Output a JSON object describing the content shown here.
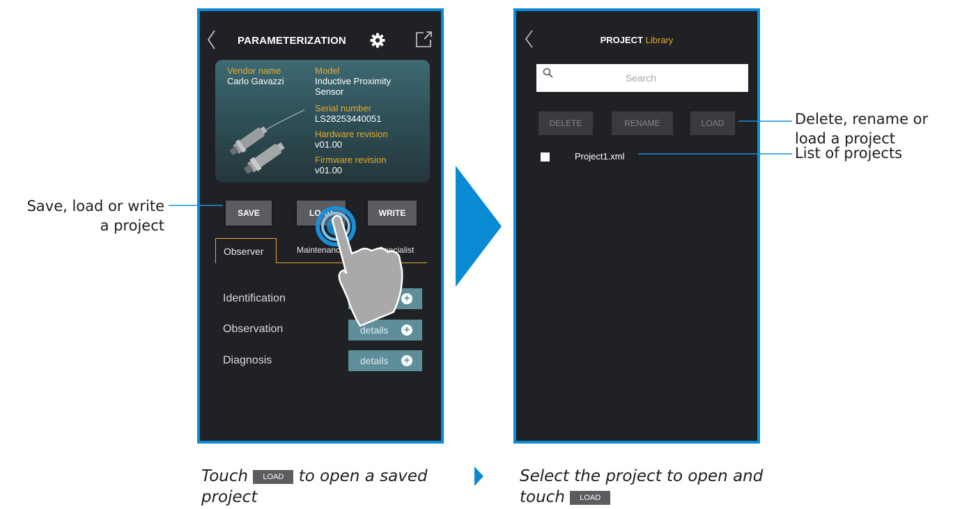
{
  "left_screen": {
    "title": "PARAMETERIZATION",
    "device": {
      "vendor_label": "Vendor name",
      "vendor_value": "Carlo Gavazzi",
      "model_label": "Model",
      "model_value_line1": "Inductive Proximity",
      "model_value_line2": "Sensor",
      "serial_label": "Serial number",
      "serial_value": "LS28253440051",
      "hardware_label": "Hardware revision",
      "hardware_value": "v01.00",
      "firmware_label": "Firmware revision",
      "firmware_value": "v01.00"
    },
    "actions": {
      "save": "SAVE",
      "load": "LOAD",
      "write": "WRITE"
    },
    "tabs": [
      "Observer",
      "Maintenance",
      "Specialist"
    ],
    "active_tab": "Observer",
    "rows": [
      {
        "label": "Identification",
        "button": "details"
      },
      {
        "label": "Observation",
        "button": "details"
      },
      {
        "label": "Diagnosis",
        "button": "details"
      }
    ]
  },
  "right_screen": {
    "title_bold": "PROJECT",
    "title_accent": "Library",
    "search_placeholder": "Search",
    "buttons": {
      "delete": "DELETE",
      "rename": "RENAME",
      "load": "LOAD"
    },
    "projects": [
      "Project1.xml"
    ]
  },
  "annotations": {
    "save_load_write_line1": "Save, load or write",
    "save_load_write_line2": "a project",
    "delete_rename_load_line1": "Delete, rename or",
    "delete_rename_load_line2": "load a project",
    "list_of_projects": "List of projects"
  },
  "captions": {
    "left_pre": "Touch",
    "left_chip": "LOAD",
    "left_post": "to open a saved",
    "left_line2": "project",
    "right_line1": "Select the project to open and",
    "right_pre": "touch",
    "right_chip": "LOAD"
  },
  "colors": {
    "frame": "#0a8ad3",
    "accent": "#e8a92a",
    "screen_bg": "#202124",
    "details": "#5d8e9a"
  }
}
